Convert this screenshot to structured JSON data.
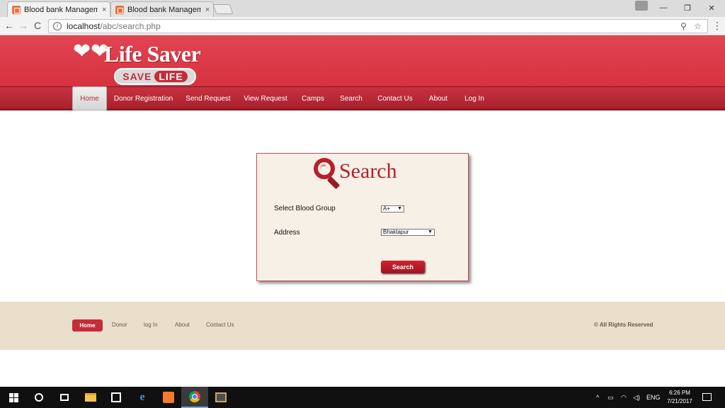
{
  "browser": {
    "tabs": [
      {
        "title": "Blood bank Managemen",
        "close": "×",
        "active": true
      },
      {
        "title": "Blood bank Managemen",
        "close": "×",
        "active": false
      }
    ],
    "window_controls": {
      "minimize": "—",
      "restore": "❐",
      "close": "✕"
    },
    "nav": {
      "back": "←",
      "forward": "→",
      "reload": "C"
    },
    "address": {
      "host": "localhost",
      "path": "/abc/search.php",
      "info": "i"
    },
    "omnibox_icons": {
      "zoom": "⚲",
      "bookmark": "☆",
      "menu": "⋮"
    }
  },
  "site": {
    "logo": {
      "hearts": "❤❤",
      "title": "Life Saver",
      "sub_left": "SAVE",
      "sub_right": "LIFE"
    },
    "nav": [
      "Home",
      "Donor Registration",
      "Send Request",
      "View Request",
      "Camps",
      "Search",
      "Contact Us",
      "About",
      "Log In"
    ],
    "active_nav": "Home"
  },
  "search": {
    "title": "Search",
    "blood_group_label": "Select Blood Group",
    "blood_group_value": "A+",
    "address_label": "Address",
    "address_value": "Bhaktapur",
    "select_arrow": "▼",
    "button": "Search"
  },
  "footer": {
    "links": [
      "Home",
      "Donor",
      "log In",
      "About",
      "Contact Us"
    ],
    "copyright": "© All Rights Reserved"
  },
  "taskbar": {
    "tray_up": "^",
    "language": "ENG",
    "time": "6:26 PM",
    "date": "7/21/2017"
  }
}
